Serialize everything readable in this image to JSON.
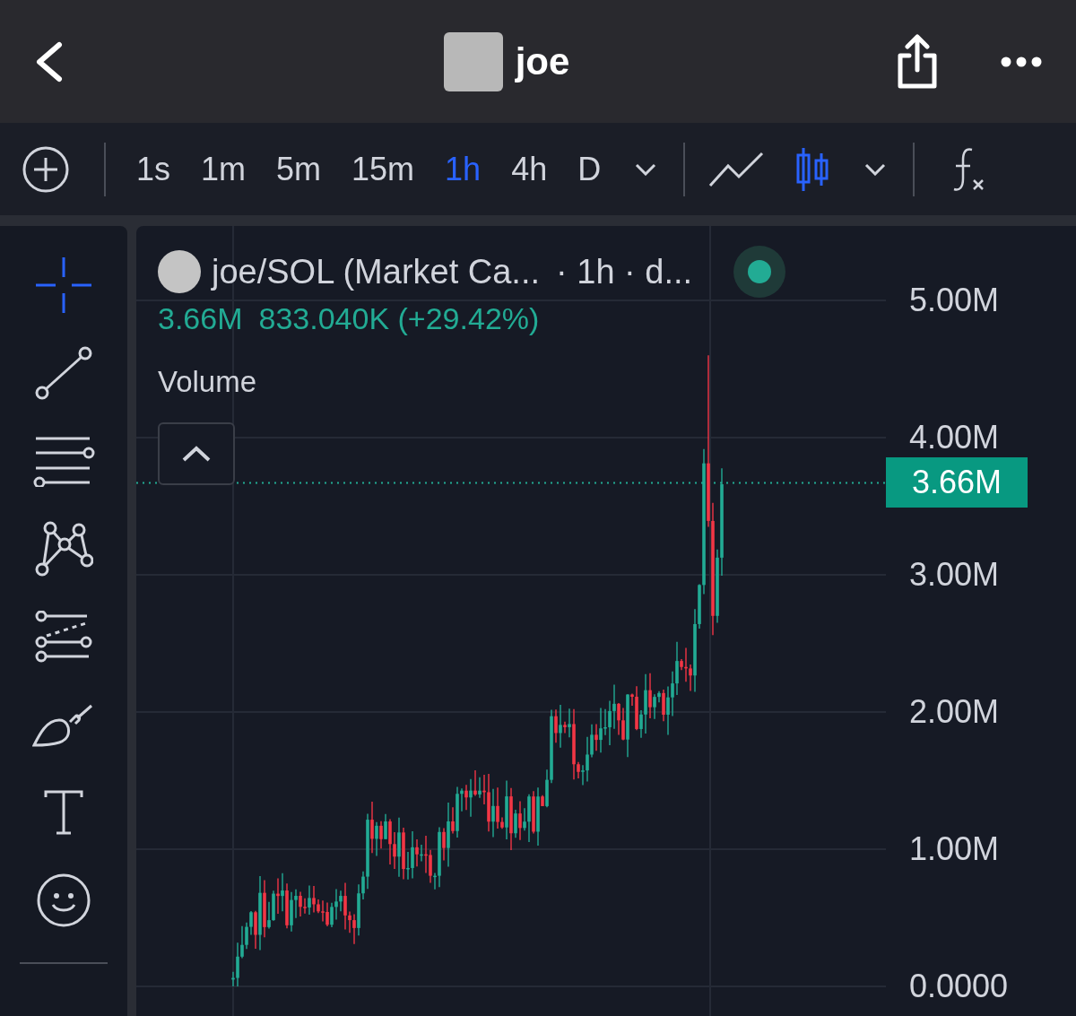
{
  "header": {
    "title": "joe"
  },
  "toolbar": {
    "intervals": [
      {
        "label": "1s",
        "selected": false
      },
      {
        "label": "1m",
        "selected": false
      },
      {
        "label": "5m",
        "selected": false
      },
      {
        "label": "15m",
        "selected": false
      },
      {
        "label": "1h",
        "selected": true
      },
      {
        "label": "4h",
        "selected": false
      },
      {
        "label": "D",
        "selected": false
      }
    ],
    "chart_types": [
      {
        "kind": "line",
        "selected": false
      },
      {
        "kind": "candles",
        "selected": true
      }
    ]
  },
  "drawing_tools": [
    {
      "kind": "crosshair",
      "selected": true
    },
    {
      "kind": "trend-line",
      "selected": false
    },
    {
      "kind": "parallel-lines",
      "selected": false
    },
    {
      "kind": "pattern",
      "selected": false
    },
    {
      "kind": "projection",
      "selected": false
    },
    {
      "kind": "brush",
      "selected": false
    },
    {
      "kind": "text",
      "selected": false
    },
    {
      "kind": "emoji",
      "selected": false
    }
  ],
  "legend": {
    "symbol": "joe/SOL (Market Ca...",
    "details": "· 1h · d...",
    "live": true,
    "price": "3.66M",
    "change": "833.040K (+29.42%)"
  },
  "volume_label": "Volume",
  "price_axis": [
    "5.00M",
    "4.00M",
    "3.00M",
    "2.00M",
    "1.00M",
    "0.0000"
  ],
  "current_price": "3.66M"
}
